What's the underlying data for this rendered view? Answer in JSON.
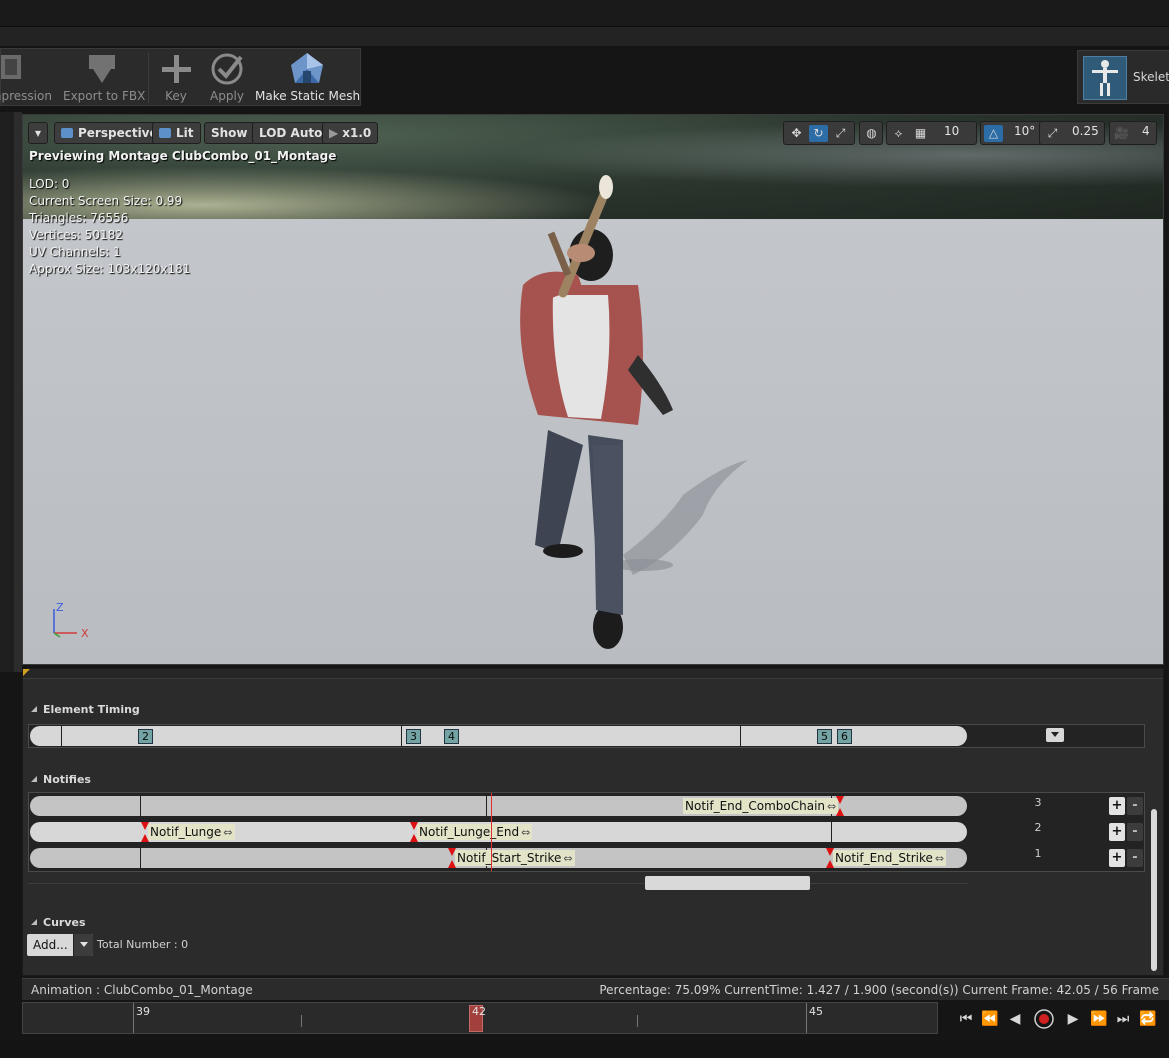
{
  "toolbar": {
    "compression_label": "Compression",
    "export_label": "Export to FBX",
    "key_label": "Key",
    "apply_label": "Apply",
    "make_static_mesh_label": "Make Static Mesh"
  },
  "asset_tab": {
    "skeleton_label": "Skeleton"
  },
  "viewport": {
    "options_arrow": "▾",
    "perspective_label": "Perspective",
    "lit_label": "Lit",
    "show_label": "Show",
    "lod_label": "LOD Auto",
    "speed_label": "x1.0",
    "grid_snap_value": "10",
    "rotation_snap_value": "10°",
    "scale_snap_value": "0.25",
    "camera_speed_value": "4",
    "preview_title": "Previewing Montage ClubCombo_01_Montage",
    "stats": [
      "LOD: 0",
      "Current Screen Size: 0.99",
      "Triangles: 76556",
      "Vertices: 50182",
      "UV Channels: 1",
      "Approx Size: 103x120x181"
    ],
    "axis_z": "Z",
    "axis_x": "X"
  },
  "element_timing": {
    "title": "Element Timing",
    "markers": [
      "2",
      "3",
      "4",
      "5",
      "6"
    ]
  },
  "notifies": {
    "title": "Notifies",
    "tracks": [
      {
        "number": "3",
        "items": [
          "Notif_End_ComboChain"
        ]
      },
      {
        "number": "2",
        "items": [
          "Notif_Lunge",
          "Notif_Lunge_End"
        ]
      },
      {
        "number": "1",
        "items": [
          "Notif_Start_Strike",
          "Notif_End_Strike"
        ]
      }
    ],
    "add_symbol": "+",
    "remove_symbol": "-"
  },
  "curves": {
    "title": "Curves",
    "add_label": "Add...",
    "total_label": "Total Number : 0"
  },
  "status": {
    "animation": "Animation :  ClubCombo_01_Montage",
    "progress": "Percentage:  75.09% CurrentTime:  1.427 / 1.900 (second(s)) Current Frame:  42.05 / 56 Frame"
  },
  "timeline": {
    "labels": [
      "39",
      "42",
      "45"
    ],
    "current_frame": 42.05
  },
  "colors": {
    "accent_blue": "#2d6da7",
    "notify_red": "#dd1111",
    "playhead": "#a2403e",
    "panel_bg": "#2b2b2b"
  }
}
